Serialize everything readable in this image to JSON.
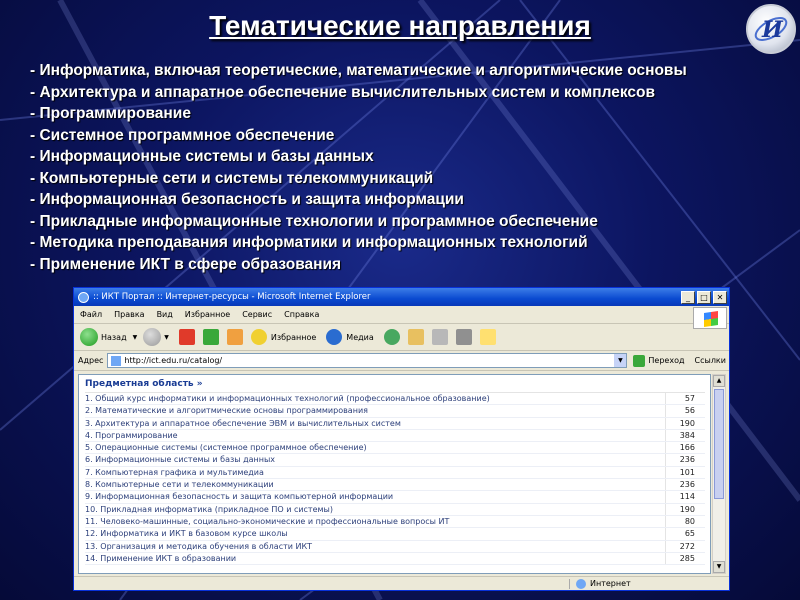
{
  "slide": {
    "title": "Тематические направления",
    "topics": [
      "Информатика, включая теоретические, математические и алгоритмические основы",
      "Архитектура и аппаратное обеспечение вычислительных систем и комплексов",
      "Программирование",
      "Системное программное обеспечение",
      "Информационные системы и базы данных",
      "Компьютерные сети и системы телекоммуникаций",
      "Информационная безопасность и защита информации",
      "Прикладные информационные технологии и программное обеспечение",
      "Методика преподавания информатики и информационных технологий",
      "Применение ИКТ в сфере образования"
    ]
  },
  "browser": {
    "title": ":: ИКТ Портал :: Интернет-ресурсы - Microsoft Internet Explorer",
    "window_buttons": {
      "minimize": "_",
      "maximize": "□",
      "close": "✕"
    },
    "menu": [
      "Файл",
      "Правка",
      "Вид",
      "Избранное",
      "Сервис",
      "Справка"
    ],
    "toolbar": {
      "back": "Назад",
      "favorites": "Избранное",
      "media": "Медиа"
    },
    "address": {
      "label": "Адрес",
      "url": "http://ict.edu.ru/catalog/",
      "go": "Переход",
      "links": "Ссылки"
    },
    "status": {
      "zone": "Интернет"
    }
  },
  "catalog": {
    "header": "Предметная область »",
    "rows": [
      {
        "name": "1. Общий курс информатики и информационных технологий (профессиональное образование)",
        "count": "57"
      },
      {
        "name": "2. Математические и алгоритмические основы программирования",
        "count": "56"
      },
      {
        "name": "3. Архитектура и аппаратное обеспечение ЭВМ и вычислительных систем",
        "count": "190"
      },
      {
        "name": "4. Программирование",
        "count": "384"
      },
      {
        "name": "5. Операционные системы (системное программное обеспечение)",
        "count": "166"
      },
      {
        "name": "6. Информационные системы и базы данных",
        "count": "236"
      },
      {
        "name": "7. Компьютерная графика и мультимедиа",
        "count": "101"
      },
      {
        "name": "8. Компьютерные сети и телекоммуникации",
        "count": "236"
      },
      {
        "name": "9. Информационная безопасность и защита компьютерной информации",
        "count": "114"
      },
      {
        "name": "10. Прикладная информатика (прикладное ПО и системы)",
        "count": "190"
      },
      {
        "name": "11. Человеко-машинные, социально-экономические и профессиональные вопросы ИТ",
        "count": "80"
      },
      {
        "name": "12. Информатика и ИКТ в базовом курсе школы",
        "count": "65"
      },
      {
        "name": "13. Организация и методика обучения в области ИКТ",
        "count": "272"
      },
      {
        "name": "14. Применение ИКТ в образовании",
        "count": "285"
      }
    ]
  },
  "colors": {
    "background": "#0c1560",
    "link": "#2c3f7a",
    "titlebar": "#0a4ad0"
  }
}
